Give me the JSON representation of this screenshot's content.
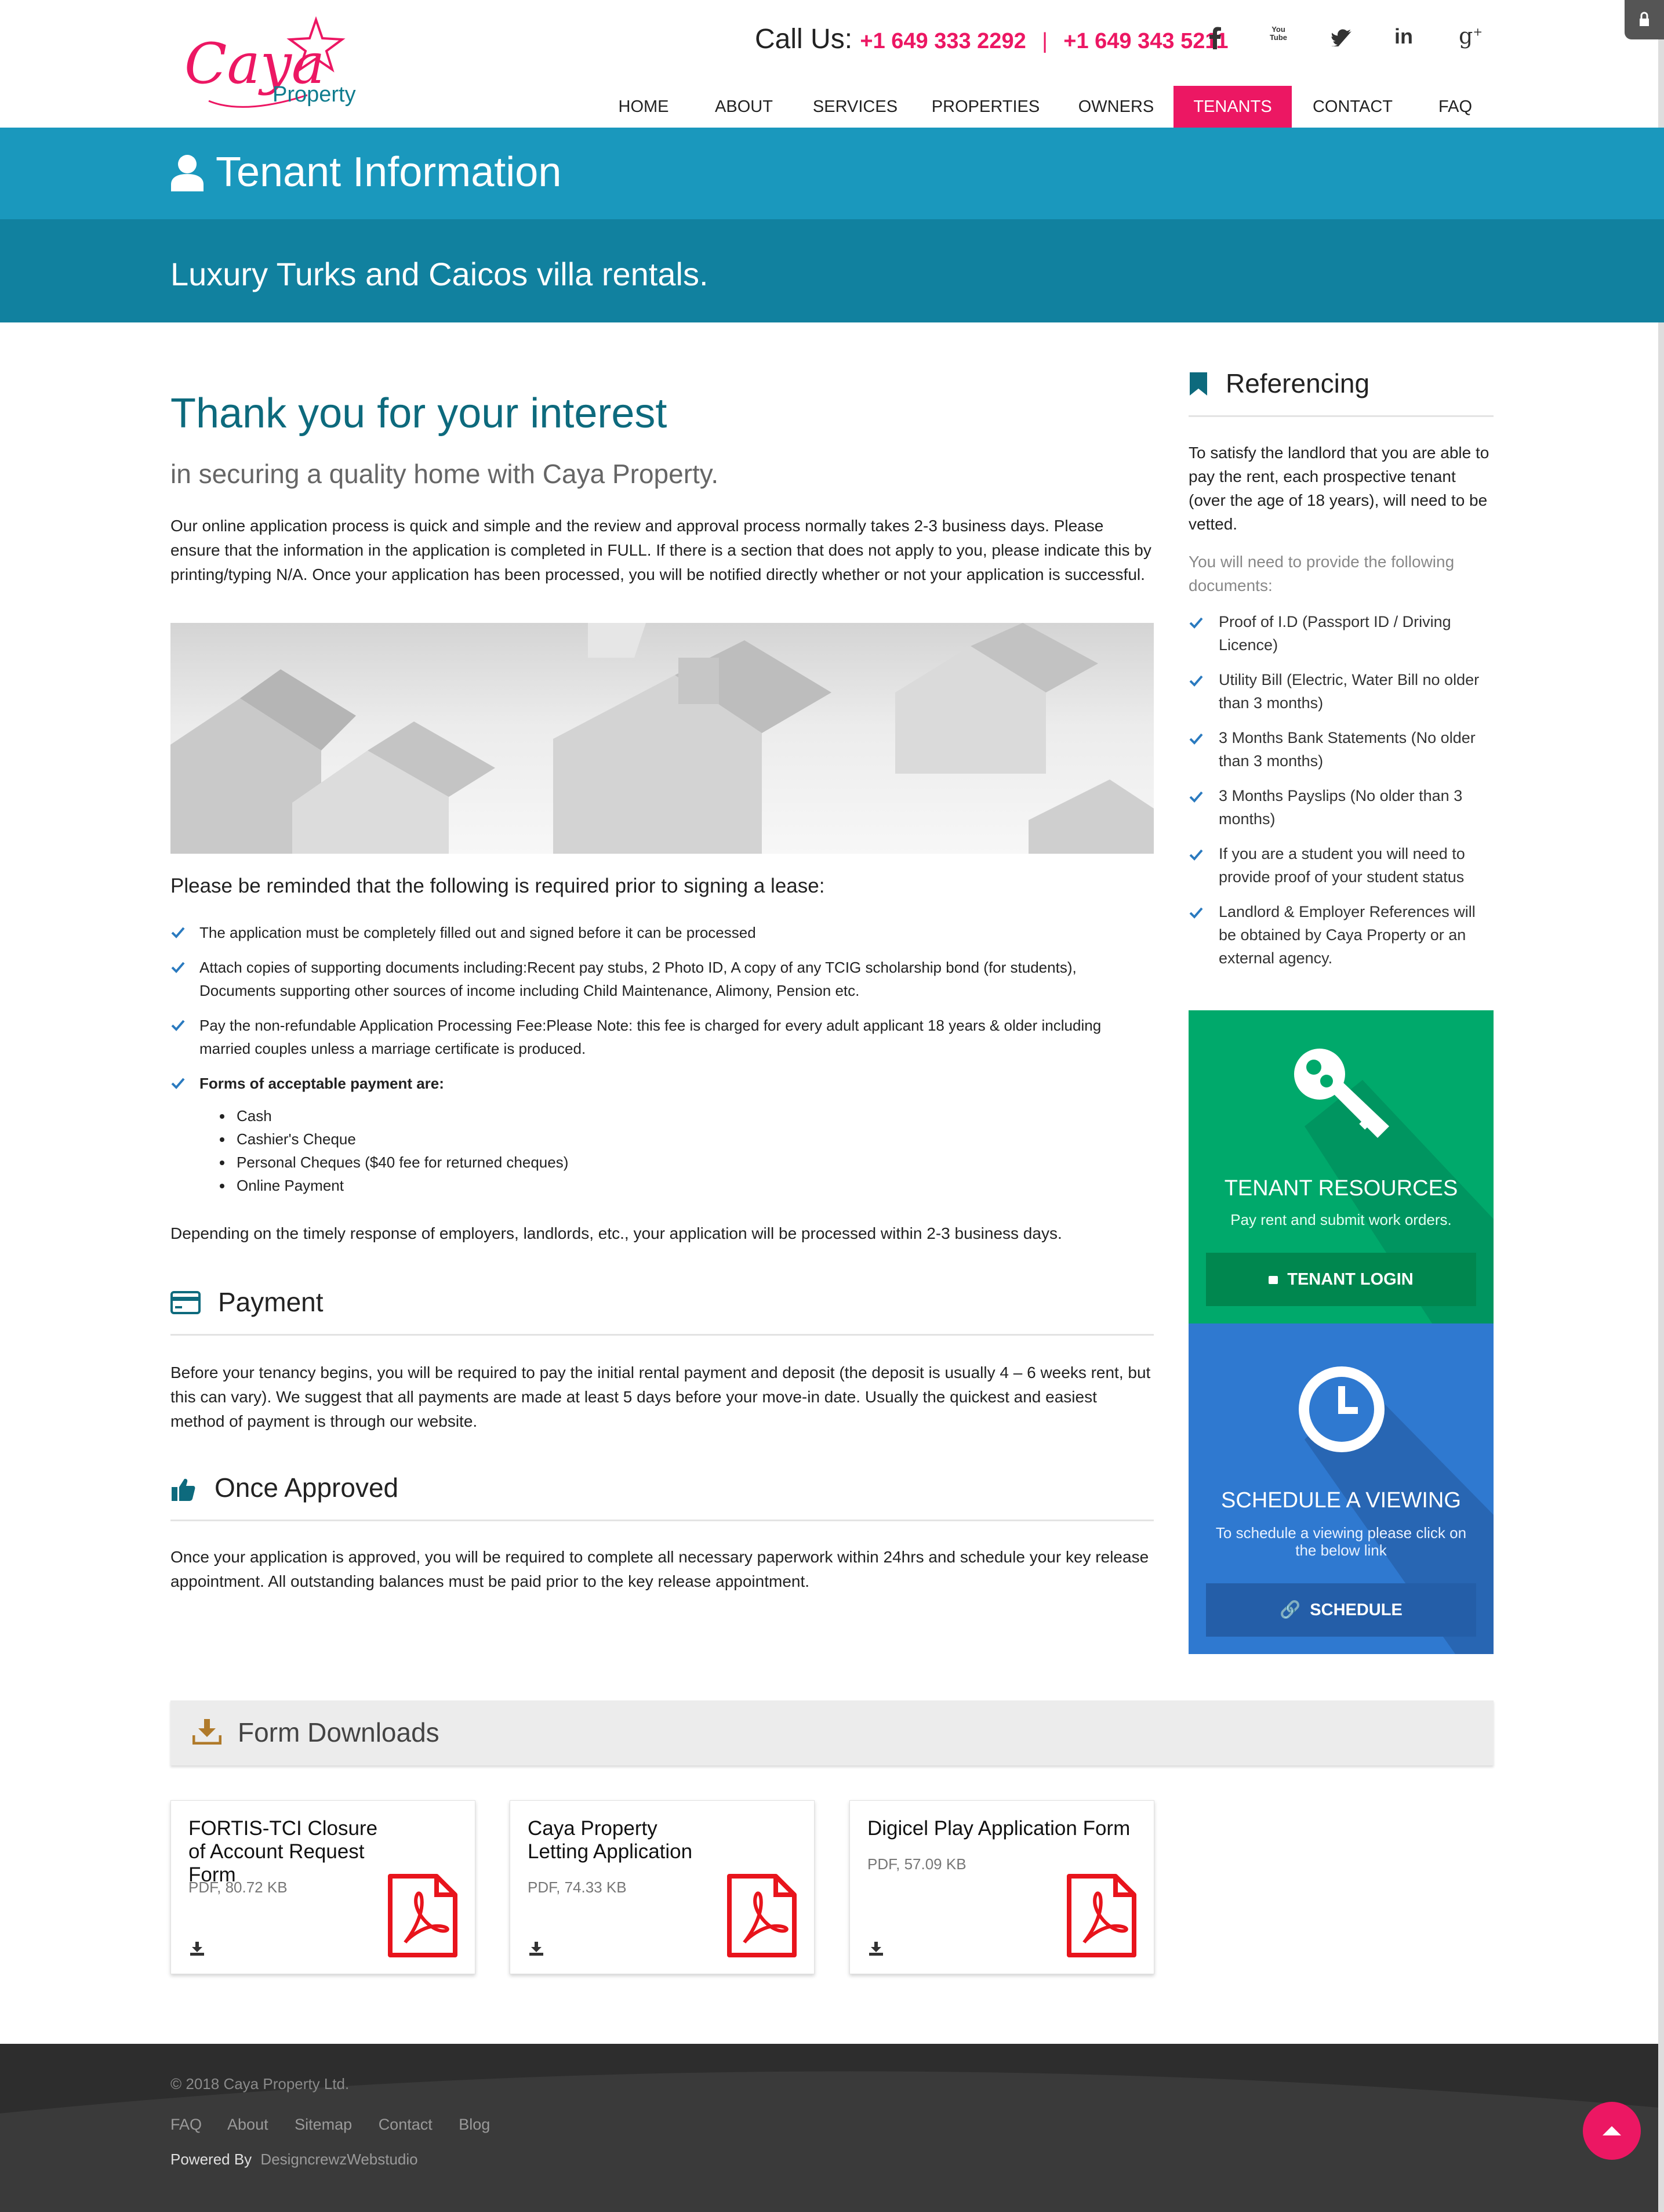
{
  "brand": {
    "name_script": "Caya",
    "name_sub": "Property"
  },
  "header": {
    "call_label": "Call Us:",
    "phone1": "+1 649 333 2292",
    "separator": "|",
    "phone2": "+1 649 343 5211",
    "social": [
      "facebook-icon",
      "youtube-icon",
      "twitter-icon",
      "linkedin-icon",
      "google-plus-icon"
    ],
    "youtube_text": "You Tube"
  },
  "nav": {
    "items": [
      "HOME",
      "ABOUT",
      "SERVICES",
      "PROPERTIES",
      "OWNERS",
      "TENANTS",
      "CONTACT",
      "FAQ"
    ],
    "active": "TENANTS"
  },
  "page": {
    "title": "Tenant Information",
    "tagline": "Luxury Turks and Caicos villa rentals."
  },
  "main": {
    "heading": "Thank you for your interest",
    "subheading": "in securing a quality home with Caya Property.",
    "intro": "Our online application process is quick and simple and the review and approval process normally takes 2-3 business days. Please ensure that the information in the application is completed in FULL. If there is a section that does not apply to you, please indicate this by printing/typing N/A. Once your application has been processed, you will be notified directly whether or not your application is successful.",
    "reminder_heading": "Please be reminded that the following is required prior to signing a lease:",
    "requirements": [
      "The application must be completely filled out and signed before it can be processed",
      "Attach copies of supporting documents including:Recent pay stubs, 2 Photo ID, A copy of any TCIG scholarship bond (for students), Documents supporting other sources of income including Child Maintenance, Alimony, Pension etc.",
      "Pay the non-refundable Application Processing Fee:Please Note: this fee is charged for every adult applicant 18 years & older including married couples unless a marriage certificate is produced.",
      "Forms of acceptable payment are:"
    ],
    "payment_forms": [
      "Cash",
      "Cashier's Cheque",
      "Personal Cheques ($40 fee for returned cheques)",
      "Online Payment"
    ],
    "processing_note": "Depending on the timely response of employers, landlords, etc., your application will be processed within 2-3 business days.",
    "payment_heading": "Payment",
    "payment_text": "Before your tenancy begins, you will be required to pay the initial rental payment and deposit (the deposit is usually 4 – 6 weeks rent, but this can vary). We suggest that all payments are made at least 5 days before your move-in date. Usually the quickest and easiest method of payment is through our website.",
    "approved_heading": "Once Approved",
    "approved_text": "Once your application is approved, you will be required to complete all necessary paperwork within 24hrs and schedule your key release appointment. All outstanding balances must be paid prior to the key release appointment."
  },
  "sidebar": {
    "heading": "Referencing",
    "intro": "To satisfy the landlord that you are able to pay the rent, each prospective tenant (over the age of 18 years), will need to be vetted.",
    "docs_label": "You will need to provide the following documents:",
    "docs": [
      "Proof of I.D (Passport ID / Driving Licence)",
      "Utility Bill (Electric, Water Bill no older than 3 months)",
      "3 Months Bank Statements (No older than 3 months)",
      "3 Months Payslips (No older than 3 months)",
      "If you are a student you will need to provide proof of your student status",
      "Landlord & Employer References will be obtained by Caya Property or an external agency."
    ],
    "resources": {
      "title": "TENANT RESOURCES",
      "text": "Pay rent and submit work orders.",
      "button": "TENANT LOGIN",
      "color": "#00a96b"
    },
    "viewing": {
      "title": "SCHEDULE A VIEWING",
      "text": "To schedule a viewing please click on the below link",
      "button": "SCHEDULE",
      "color": "#2f79d0"
    }
  },
  "downloads": {
    "heading": "Form Downloads",
    "forms": [
      {
        "title": "FORTIS-TCI Closure of Account Request Form",
        "meta": "PDF, 80.72 KB"
      },
      {
        "title": "Caya Property Letting Application",
        "meta": "PDF, 74.33 KB"
      },
      {
        "title": "Digicel Play Application Form",
        "meta": "PDF, 57.09 KB"
      }
    ]
  },
  "footer": {
    "copyright": "© 2018 Caya Property Ltd.",
    "links": [
      "FAQ",
      "About",
      "Sitemap",
      "Contact",
      "Blog"
    ],
    "powered_label": "Powered By",
    "powered_name": "DesigncrewzWebstudio"
  },
  "colors": {
    "accent": "#ec1763",
    "teal": "#1a98bd",
    "teal_dark": "#11819f",
    "heading": "#0d6a7d"
  }
}
